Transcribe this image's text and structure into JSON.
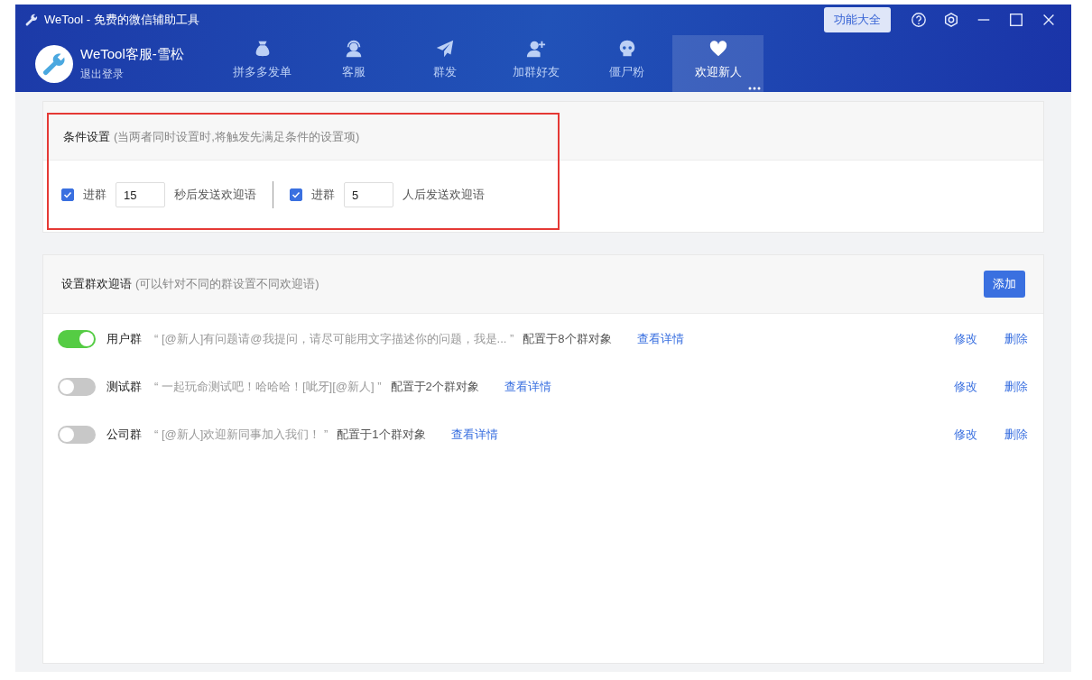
{
  "window": {
    "title": "WeTool - 免费的微信辅助工具"
  },
  "account": {
    "name": "WeTool客服-雪松",
    "logout": "退出登录"
  },
  "nav": [
    {
      "label": "拼多多发单",
      "selected": false
    },
    {
      "label": "客服",
      "selected": false
    },
    {
      "label": "群发",
      "selected": false
    },
    {
      "label": "加群好友",
      "selected": false
    },
    {
      "label": "僵尸粉",
      "selected": false
    },
    {
      "label": "欢迎新人",
      "selected": true
    }
  ],
  "toolbar": {
    "features_button": "功能大全"
  },
  "conditions": {
    "title": "条件设置",
    "hint": "(当两者同时设置时,将触发先满足条件的设置项)",
    "items": [
      {
        "checked": true,
        "prefix": "进群",
        "value": "15",
        "suffix": "秒后发送欢迎语"
      },
      {
        "checked": true,
        "prefix": "进群",
        "value": "5",
        "suffix": "人后发送欢迎语"
      }
    ]
  },
  "greetings": {
    "title": "设置群欢迎语",
    "hint": "(可以针对不同的群设置不同欢迎语)",
    "add_button": "添加",
    "rows": [
      {
        "on": true,
        "group": "用户群",
        "message": "“ [@新人]有问题请@我提问，请尽可能用文字描述你的问题，我是... ”",
        "config": "配置于8个群对象",
        "details": "查看详情",
        "edit": "修改",
        "delete": "删除"
      },
      {
        "on": false,
        "group": "测试群",
        "message": "“ 一起玩命测试吧！哈哈哈！[呲牙][@新人] ”",
        "config": "配置于2个群对象",
        "details": "查看详情",
        "edit": "修改",
        "delete": "删除"
      },
      {
        "on": false,
        "group": "公司群",
        "message": "“ [@新人]欢迎新同事加入我们！ ”",
        "config": "配置于1个群对象",
        "details": "查看详情",
        "edit": "修改",
        "delete": "删除"
      }
    ]
  }
}
